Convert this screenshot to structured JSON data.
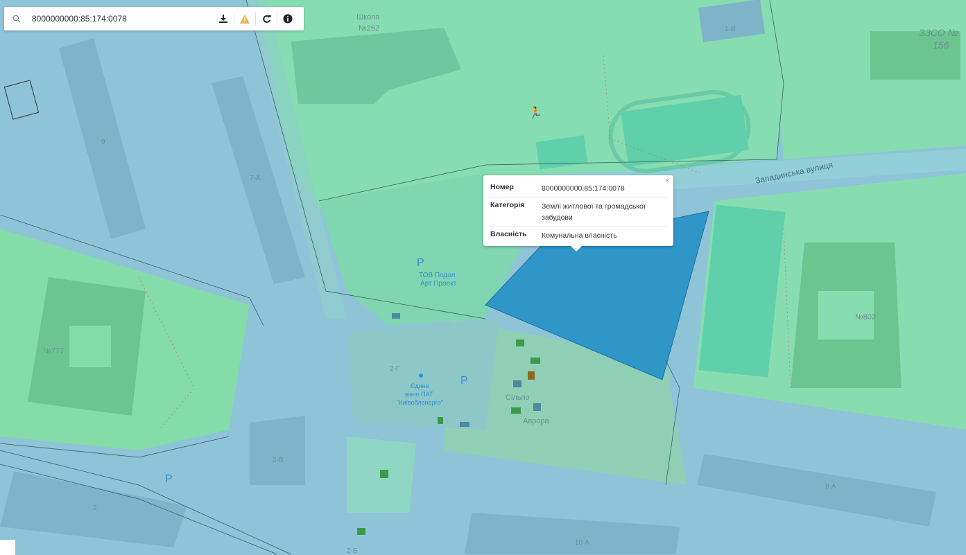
{
  "search": {
    "value": "8000000000:85:174:0078",
    "placeholder": ""
  },
  "toolbar": {
    "icons": [
      "search-icon",
      "download-icon",
      "warning-icon",
      "refresh-icon",
      "info-icon"
    ],
    "warning_color": "#f0ad4e"
  },
  "popup": {
    "close_label": "×",
    "rows": [
      {
        "key": "Номер",
        "value": "8000000000:85:174:0078"
      },
      {
        "key": "Категорія",
        "value": "Землі житлової та громадської забудови"
      },
      {
        "key": "Власність",
        "value": "Комунальна власність"
      }
    ]
  },
  "map_labels": {
    "school_262": [
      "Школа",
      "№262"
    ],
    "zzso_156": [
      "ЗЗСО №",
      "156"
    ],
    "street": "Западинська вулиця",
    "parking_company": [
      "ТОВ Подол",
      "Арт Проект"
    ],
    "single_window": [
      "Єдине",
      "вікно ПАТ",
      "\"Київобленерго\""
    ],
    "shop_silpo": "Сільпо",
    "shop_avrora": "Аврора",
    "num_777": "№777",
    "num_802": "№802",
    "house_7a": "7-А",
    "house_1v": "1-В",
    "house_9": "9",
    "house_2g": "2-Г",
    "house_2v": "2-В",
    "house_2": "2",
    "house_8a": "8-А",
    "house_10a": "10-А",
    "house_2b": "2-Б",
    "parking_symbol": "P"
  },
  "colors": {
    "residential_green": "#7fdcae",
    "parcel_blue": "#8fc3d8",
    "selected_parcel": "#2f96c8"
  }
}
